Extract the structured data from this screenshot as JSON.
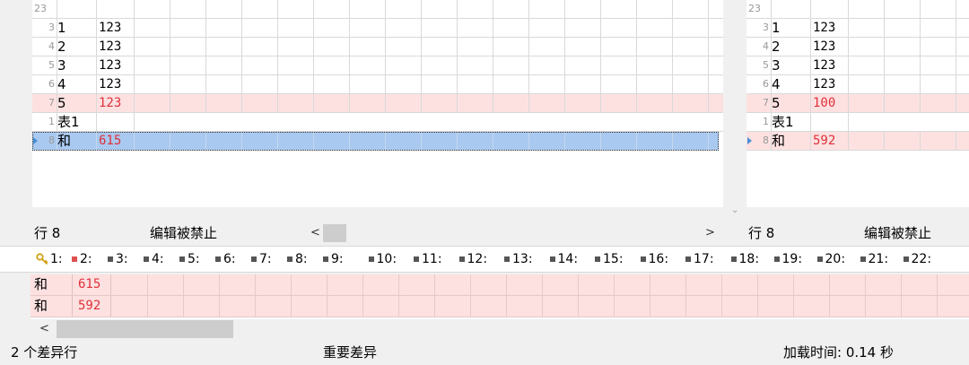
{
  "left_grid": {
    "header_rownum": "23",
    "rows": [
      {
        "num": "3",
        "key": "1",
        "value": "123",
        "state": "same"
      },
      {
        "num": "4",
        "key": "2",
        "value": "123",
        "state": "same"
      },
      {
        "num": "5",
        "key": "3",
        "value": "123",
        "state": "same"
      },
      {
        "num": "6",
        "key": "4",
        "value": "123",
        "state": "same"
      },
      {
        "num": "7",
        "key": "5",
        "value": "123",
        "state": "diff"
      },
      {
        "num": "1",
        "key": "表1",
        "value": "",
        "state": "plain"
      },
      {
        "num": "8",
        "key": "和",
        "value": "615",
        "state": "selected"
      }
    ],
    "row_label": "行 8",
    "edit_status": "编辑被禁止",
    "scroll_left": "<",
    "scroll_right": ">"
  },
  "right_grid": {
    "header_rownum": "23",
    "rows": [
      {
        "num": "3",
        "key": "1",
        "value": "123",
        "state": "same"
      },
      {
        "num": "4",
        "key": "2",
        "value": "123",
        "state": "same"
      },
      {
        "num": "5",
        "key": "3",
        "value": "123",
        "state": "same"
      },
      {
        "num": "6",
        "key": "4",
        "value": "123",
        "state": "same"
      },
      {
        "num": "7",
        "key": "5",
        "value": "100",
        "state": "diff"
      },
      {
        "num": "1",
        "key": "表1",
        "value": "",
        "state": "plain"
      },
      {
        "num": "8",
        "key": "和",
        "value": "592",
        "state": "diffsel"
      }
    ],
    "row_label": "行 8",
    "edit_status": "编辑被禁止",
    "scroll_down": "⌄"
  },
  "column_headers": [
    "1:",
    "2:",
    "3:",
    "4:",
    "5:",
    "6:",
    "7:",
    "8:",
    "9:",
    "10:",
    "11:",
    "12:",
    "13:",
    "14:",
    "15:",
    "16:",
    "17:",
    "18:",
    "19:",
    "20:",
    "21:",
    "22:"
  ],
  "column_header_icons": {
    "first": "key-icon",
    "second": "red-square-icon",
    "rest": "gray-square-icon"
  },
  "diff_rows": [
    {
      "key": "和",
      "value": "615"
    },
    {
      "key": "和",
      "value": "592"
    }
  ],
  "bottom_scroll_left": "<",
  "status": {
    "diff_count": "2 个差异行",
    "severity": "重要差异",
    "load_time": "加载时间: 0.14 秒"
  },
  "colors": {
    "diff_bg": "#fde1e1",
    "diff_text": "#e0303a",
    "selected_bg": "#a9c9f0",
    "marker": "#4a8fd6"
  }
}
